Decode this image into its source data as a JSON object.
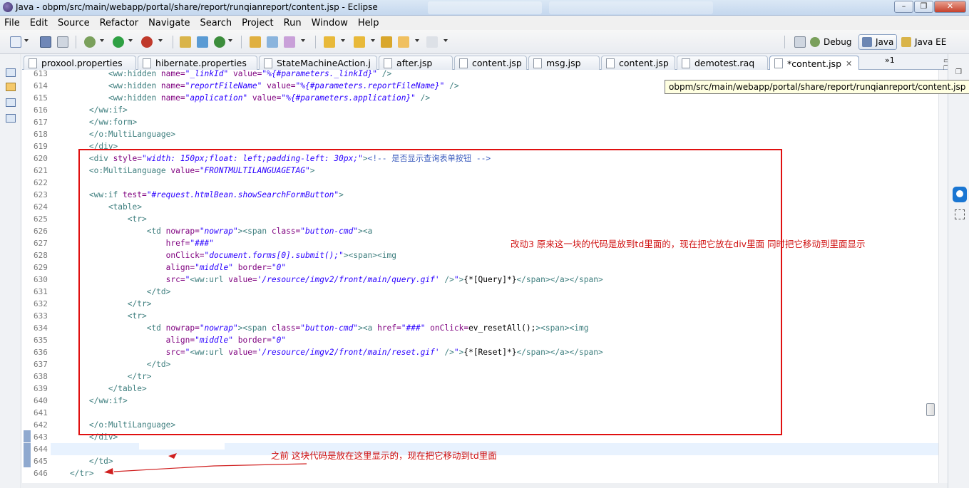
{
  "window": {
    "title": "Java - obpm/src/main/webapp/portal/share/report/runqianreport/content.jsp - Eclipse",
    "buttons": {
      "minimize": "–",
      "maximize": "❐",
      "close": "✕"
    }
  },
  "menu": [
    "File",
    "Edit",
    "Source",
    "Refactor",
    "Navigate",
    "Search",
    "Project",
    "Run",
    "Window",
    "Help"
  ],
  "perspectives": [
    {
      "label": "Debug",
      "active": false
    },
    {
      "label": "Java",
      "active": true
    },
    {
      "label": "Java EE",
      "active": false
    }
  ],
  "tabs": [
    {
      "label": "proxool.properties"
    },
    {
      "label": "hibernate.properties"
    },
    {
      "label": "StateMachineAction.j"
    },
    {
      "label": "after.jsp"
    },
    {
      "label": "content.jsp"
    },
    {
      "label": "msg.jsp"
    },
    {
      "label": "content.jsp"
    },
    {
      "label": "demotest.raq"
    },
    {
      "label": "*content.jsp",
      "active": true,
      "close": "✕"
    }
  ],
  "tab_overflow": "»1",
  "tooltip": "obpm/src/main/webapp/portal/share/report/runqianreport/content.jsp",
  "editor": {
    "lines": [
      {
        "n": "613",
        "tokens": [
          [
            "t",
            "            <ww:hidden "
          ],
          [
            "a",
            "name="
          ],
          [
            "v",
            "\"_linkId\""
          ],
          [
            "a",
            " value="
          ],
          [
            "v",
            "\"%{#parameters._linkId}\""
          ],
          [
            "t",
            " />"
          ]
        ]
      },
      {
        "n": "614",
        "tokens": [
          [
            "t",
            "            <ww:hidden "
          ],
          [
            "a",
            "name="
          ],
          [
            "v",
            "\"reportFileName\""
          ],
          [
            "a",
            " value="
          ],
          [
            "v",
            "\"%{#parameters.reportFileName}\""
          ],
          [
            "t",
            " />"
          ]
        ]
      },
      {
        "n": "615",
        "tokens": [
          [
            "t",
            "            <ww:hidden "
          ],
          [
            "a",
            "name="
          ],
          [
            "v",
            "\"application\""
          ],
          [
            "a",
            " value="
          ],
          [
            "v",
            "\"%{#parameters.application}\""
          ],
          [
            "t",
            " />"
          ]
        ]
      },
      {
        "n": "616",
        "tokens": [
          [
            "t",
            "        </ww:if>"
          ]
        ]
      },
      {
        "n": "617",
        "tokens": [
          [
            "t",
            "        </ww:form>"
          ]
        ]
      },
      {
        "n": "618",
        "tokens": [
          [
            "t",
            "        </o:MultiLanguage>"
          ]
        ]
      },
      {
        "n": "619",
        "tokens": [
          [
            "t",
            "        </div>"
          ]
        ]
      },
      {
        "n": "620",
        "tokens": [
          [
            "t",
            "        <div "
          ],
          [
            "a",
            "style="
          ],
          [
            "v",
            "\"width: 150px;float: left;padding-left: 30px;\""
          ],
          [
            "t",
            ">"
          ],
          [
            "c",
            "<!-- 是否显示查询表单按钮 -->"
          ]
        ]
      },
      {
        "n": "621",
        "tokens": [
          [
            "t",
            "        <o:MultiLanguage "
          ],
          [
            "a",
            "value="
          ],
          [
            "v",
            "\"FRONTMULTILANGUAGETAG\""
          ],
          [
            "t",
            ">"
          ]
        ]
      },
      {
        "n": "622",
        "tokens": []
      },
      {
        "n": "623",
        "tokens": [
          [
            "t",
            "        <ww:if "
          ],
          [
            "a",
            "test="
          ],
          [
            "v",
            "\"#request.htmlBean.showSearchFormButton\""
          ],
          [
            "t",
            ">"
          ]
        ]
      },
      {
        "n": "624",
        "tokens": [
          [
            "t",
            "            <table>"
          ]
        ]
      },
      {
        "n": "625",
        "tokens": [
          [
            "t",
            "                <tr>"
          ]
        ]
      },
      {
        "n": "626",
        "tokens": [
          [
            "t",
            "                    <td "
          ],
          [
            "a",
            "nowrap="
          ],
          [
            "v",
            "\"nowrap\""
          ],
          [
            "t",
            "><span "
          ],
          [
            "a",
            "class="
          ],
          [
            "v",
            "\"button-cmd\""
          ],
          [
            "t",
            "><a"
          ]
        ]
      },
      {
        "n": "627",
        "tokens": [
          [
            "t",
            "                        "
          ],
          [
            "a",
            "href="
          ],
          [
            "v",
            "\"###\""
          ]
        ]
      },
      {
        "n": "628",
        "tokens": [
          [
            "t",
            "                        "
          ],
          [
            "a",
            "onClick="
          ],
          [
            "v",
            "\"document.forms[0].submit();\""
          ],
          [
            "t",
            "><span><img"
          ]
        ]
      },
      {
        "n": "629",
        "tokens": [
          [
            "t",
            "                        "
          ],
          [
            "a",
            "align="
          ],
          [
            "v",
            "\"middle\""
          ],
          [
            "a",
            " border="
          ],
          [
            "v",
            "\"0\""
          ]
        ]
      },
      {
        "n": "630",
        "tokens": [
          [
            "t",
            "                        "
          ],
          [
            "a",
            "src="
          ],
          [
            "v",
            "\""
          ],
          [
            "t",
            "<ww:url "
          ],
          [
            "a",
            "value="
          ],
          [
            "v",
            "'/resource/imgv2/front/main/query.gif'"
          ],
          [
            "t",
            " />"
          ],
          [
            "v",
            "\""
          ],
          [
            "t",
            ">"
          ],
          [
            "x",
            "{*[Query]*}"
          ],
          [
            "t",
            "</span></a></span>"
          ]
        ]
      },
      {
        "n": "631",
        "tokens": [
          [
            "t",
            "                    </td>"
          ]
        ]
      },
      {
        "n": "632",
        "tokens": [
          [
            "t",
            "                </tr>"
          ]
        ]
      },
      {
        "n": "633",
        "tokens": [
          [
            "t",
            "                <tr>"
          ]
        ]
      },
      {
        "n": "634",
        "tokens": [
          [
            "t",
            "                    <td "
          ],
          [
            "a",
            "nowrap="
          ],
          [
            "v",
            "\"nowrap\""
          ],
          [
            "t",
            "><span "
          ],
          [
            "a",
            "class="
          ],
          [
            "v",
            "\"button-cmd\""
          ],
          [
            "t",
            "><a "
          ],
          [
            "a",
            "href="
          ],
          [
            "v",
            "\"###\""
          ],
          [
            "a",
            " onClick="
          ],
          [
            "x",
            "ev_resetAll();"
          ],
          [
            "t",
            "><span><img"
          ]
        ]
      },
      {
        "n": "635",
        "tokens": [
          [
            "t",
            "                        "
          ],
          [
            "a",
            "align="
          ],
          [
            "v",
            "\"middle\""
          ],
          [
            "a",
            " border="
          ],
          [
            "v",
            "\"0\""
          ]
        ]
      },
      {
        "n": "636",
        "tokens": [
          [
            "t",
            "                        "
          ],
          [
            "a",
            "src="
          ],
          [
            "v",
            "\""
          ],
          [
            "t",
            "<ww:url "
          ],
          [
            "a",
            "value="
          ],
          [
            "v",
            "'/resource/imgv2/front/main/reset.gif'"
          ],
          [
            "t",
            " />"
          ],
          [
            "v",
            "\""
          ],
          [
            "t",
            ">"
          ],
          [
            "x",
            "{*[Reset]*}"
          ],
          [
            "t",
            "</span></a></span>"
          ]
        ]
      },
      {
        "n": "637",
        "tokens": [
          [
            "t",
            "                    </td>"
          ]
        ]
      },
      {
        "n": "638",
        "tokens": [
          [
            "t",
            "                </tr>"
          ]
        ]
      },
      {
        "n": "639",
        "tokens": [
          [
            "t",
            "            </table>"
          ]
        ]
      },
      {
        "n": "640",
        "tokens": [
          [
            "t",
            "        </ww:if>"
          ]
        ]
      },
      {
        "n": "641",
        "tokens": []
      },
      {
        "n": "642",
        "tokens": [
          [
            "t",
            "        </o:MultiLanguage>"
          ]
        ]
      },
      {
        "n": "643",
        "tokens": [
          [
            "t",
            "        </div>"
          ]
        ]
      },
      {
        "n": "644",
        "tokens": []
      },
      {
        "n": "645",
        "tokens": [
          [
            "t",
            "        </td>"
          ]
        ]
      },
      {
        "n": "646",
        "tokens": [
          [
            "t",
            "    </tr>"
          ]
        ]
      }
    ]
  },
  "annotations": {
    "note_right": "改动3 原来这一块的代码是放到td里面的，现在把它放在div里面 同时把它移动到里面显示",
    "note_bottom": "之前 这块代码是放在这里显示的，现在把它移动到td里面"
  }
}
